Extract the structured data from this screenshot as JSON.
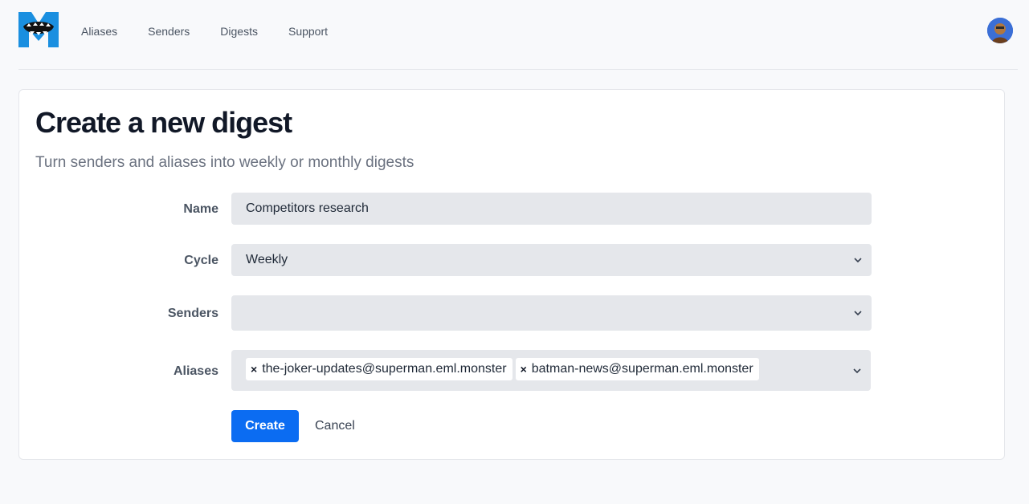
{
  "nav": {
    "logo_icon": "monster-logo-icon",
    "items": [
      {
        "label": "Aliases"
      },
      {
        "label": "Senders"
      },
      {
        "label": "Digests"
      },
      {
        "label": "Support"
      }
    ],
    "avatar_icon": "user-avatar"
  },
  "page": {
    "title": "Create a new digest",
    "subtitle": "Turn senders and aliases into weekly or monthly digests"
  },
  "form": {
    "name": {
      "label": "Name",
      "value": "Competitors research"
    },
    "cycle": {
      "label": "Cycle",
      "value": "Weekly"
    },
    "senders": {
      "label": "Senders",
      "value": ""
    },
    "aliases": {
      "label": "Aliases",
      "selected": [
        "the-joker-updates@superman.eml.monster",
        "batman-news@superman.eml.monster"
      ]
    },
    "create_label": "Create",
    "cancel_label": "Cancel"
  },
  "colors": {
    "primary": "#0b6cf2",
    "logo": "#1a8fe0",
    "field_bg": "#e5e7eb"
  }
}
